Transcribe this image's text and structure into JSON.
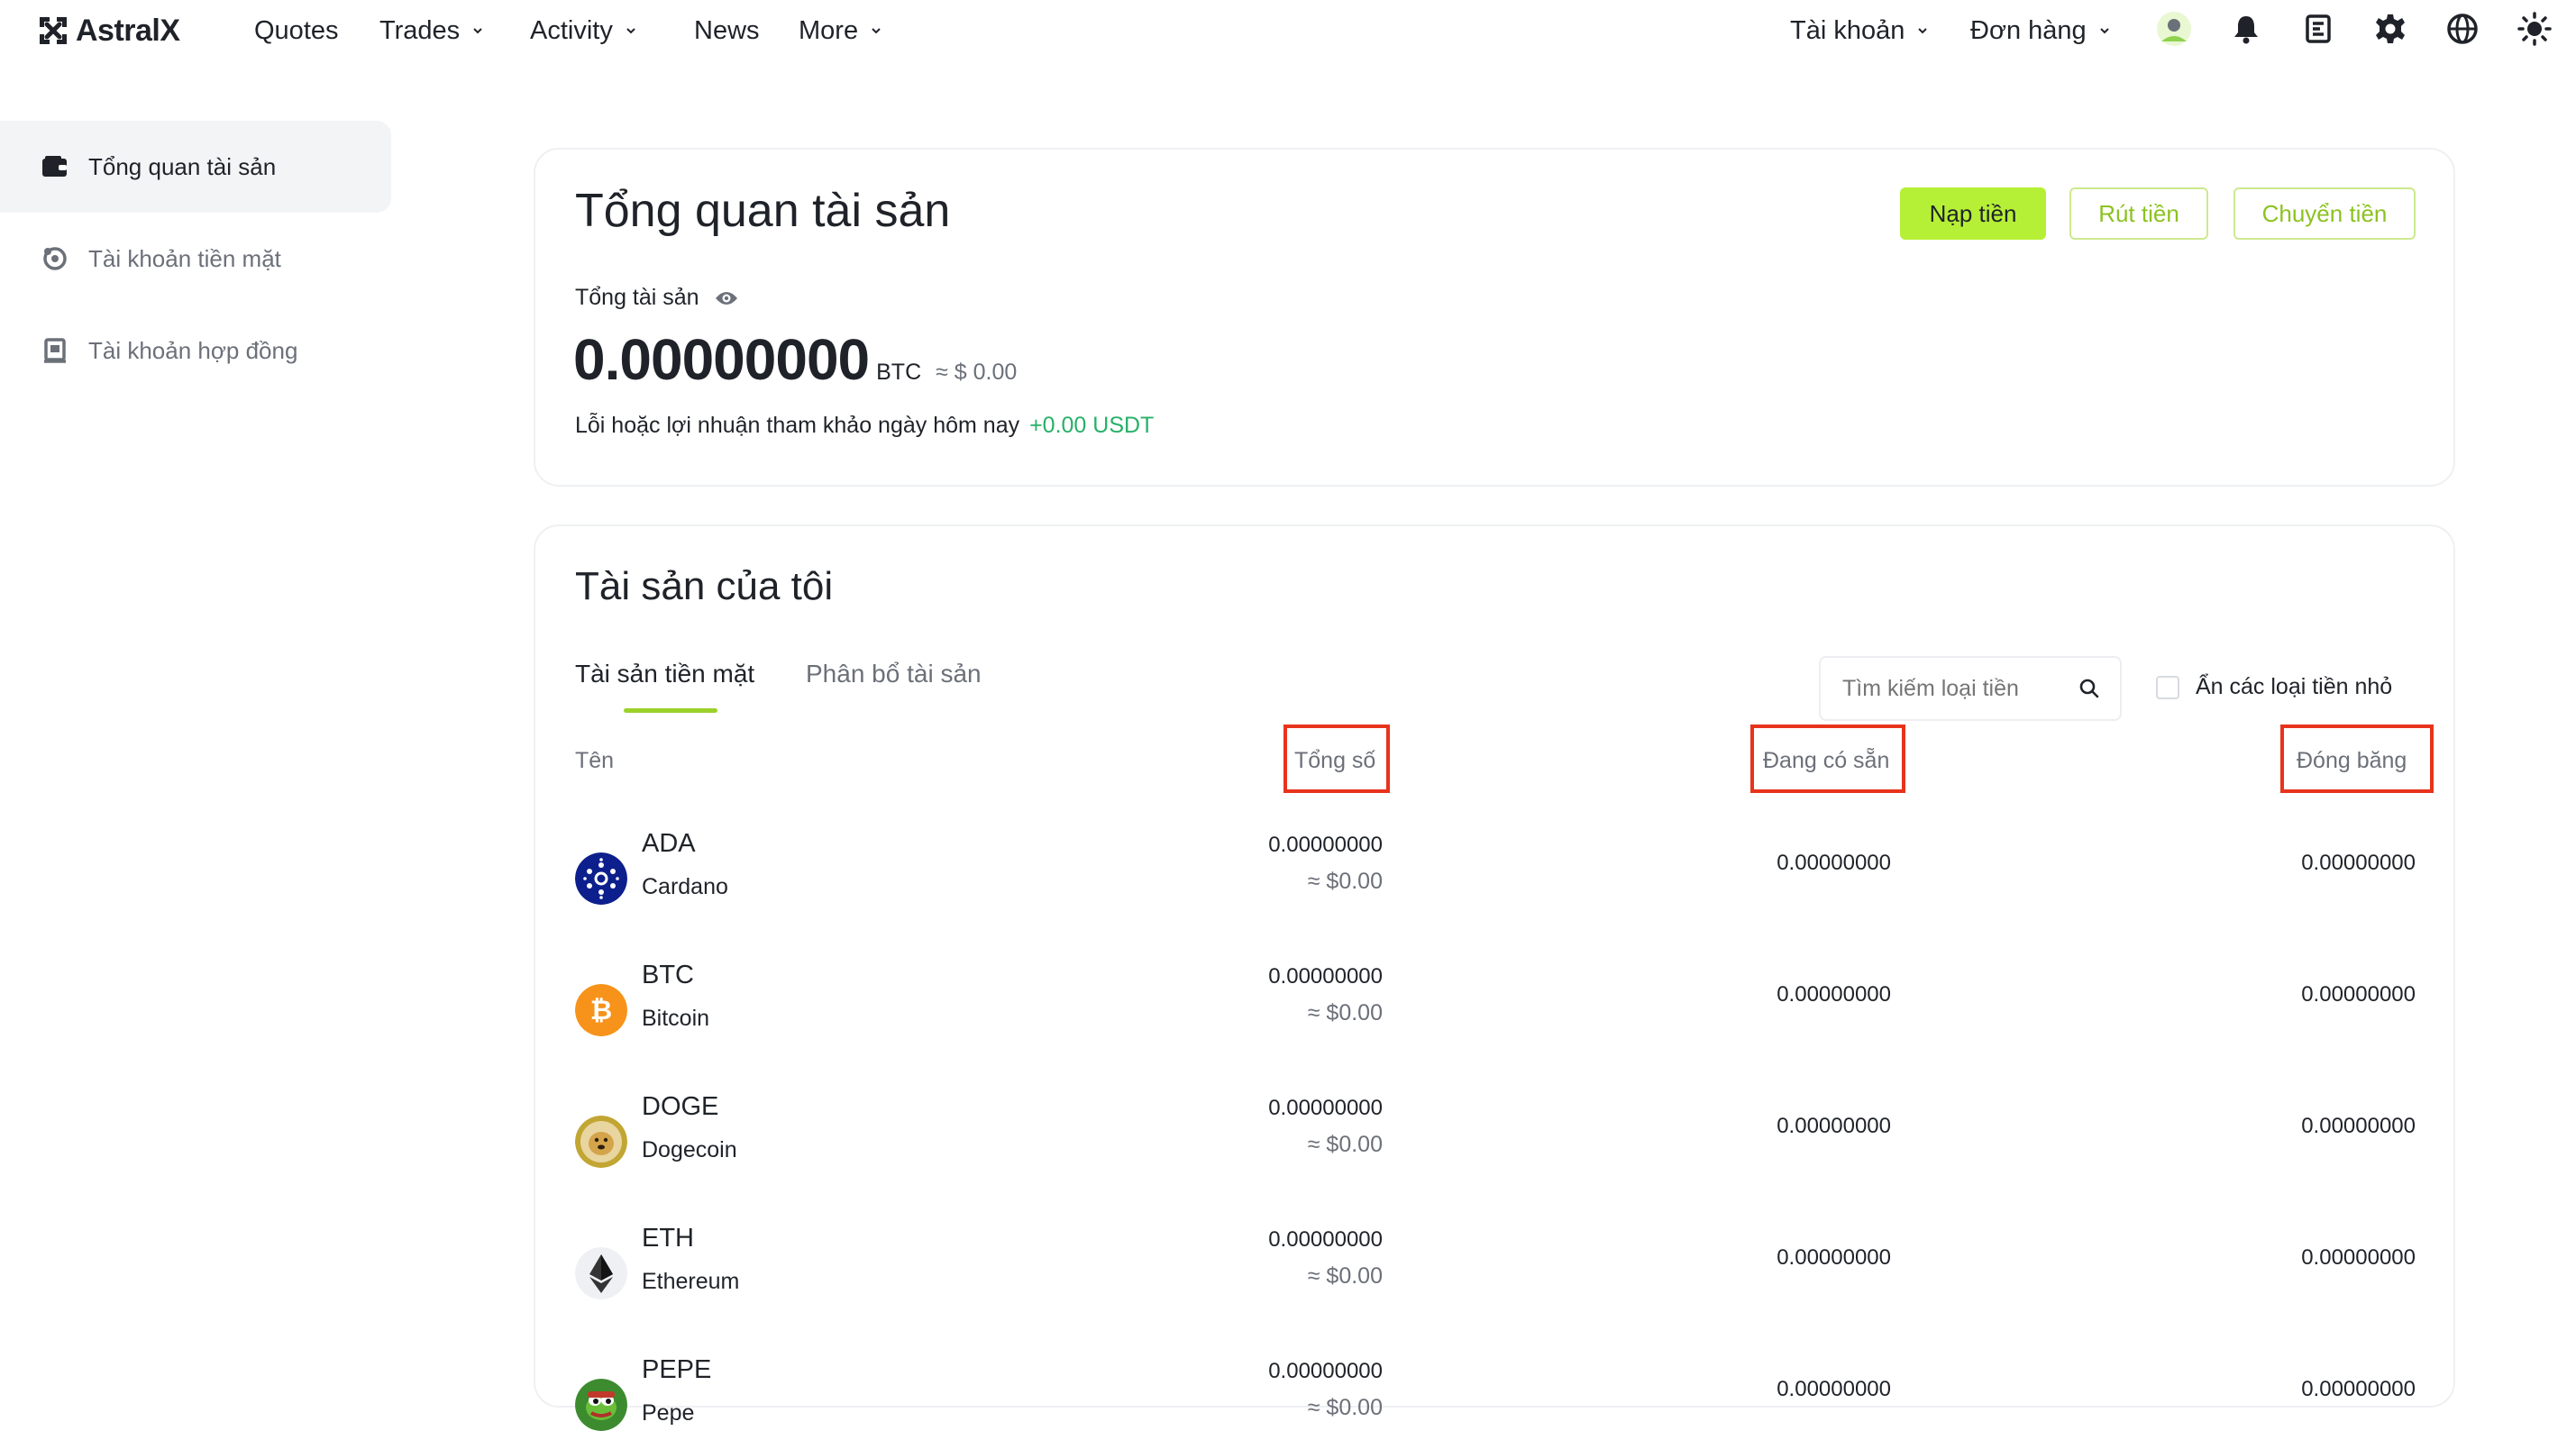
{
  "brand": {
    "name": "AstralX"
  },
  "nav": {
    "quotes": "Quotes",
    "trades": "Trades",
    "activity": "Activity",
    "news": "News",
    "more": "More",
    "account": "Tài khoản",
    "orders": "Đơn hàng"
  },
  "sidebar": {
    "items": [
      {
        "label": "Tổng quan tài sản",
        "icon": "wallet-icon"
      },
      {
        "label": "Tài khoản tiền mặt",
        "icon": "cash-icon"
      },
      {
        "label": "Tài khoản hợp đồng",
        "icon": "contract-icon"
      }
    ]
  },
  "overview": {
    "title": "Tổng quan tài sản",
    "deposit": "Nạp tiền",
    "withdraw": "Rút tiền",
    "transfer": "Chuyển tiền",
    "total_label": "Tổng tài sản",
    "total_value": "0.00000000",
    "total_unit": "BTC",
    "total_usd": "≈ $ 0.00",
    "pnl_label": "Lỗi hoặc lợi nhuận tham khảo ngày hôm nay",
    "pnl_value": "+0.00 USDT"
  },
  "assets": {
    "title": "Tài sản của tôi",
    "tabs": [
      "Tài sản tiền mặt",
      "Phân bổ tài sản"
    ],
    "search_placeholder": "Tìm kiếm loại tiền",
    "hide_small": "Ẩn các loại tiền nhỏ",
    "columns": {
      "name": "Tên",
      "total": "Tổng số",
      "available": "Đang có sẵn",
      "frozen": "Đóng băng"
    },
    "rows": [
      {
        "symbol": "ADA",
        "name": "Cardano",
        "total": "0.00000000",
        "usd": "≈ $0.00",
        "available": "0.00000000",
        "frozen": "0.00000000"
      },
      {
        "symbol": "BTC",
        "name": "Bitcoin",
        "total": "0.00000000",
        "usd": "≈ $0.00",
        "available": "0.00000000",
        "frozen": "0.00000000"
      },
      {
        "symbol": "DOGE",
        "name": "Dogecoin",
        "total": "0.00000000",
        "usd": "≈ $0.00",
        "available": "0.00000000",
        "frozen": "0.00000000"
      },
      {
        "symbol": "ETH",
        "name": "Ethereum",
        "total": "0.00000000",
        "usd": "≈ $0.00",
        "available": "0.00000000",
        "frozen": "0.00000000"
      },
      {
        "symbol": "PEPE",
        "name": "Pepe",
        "total": "0.00000000",
        "usd": "≈ $0.00",
        "available": "0.00000000",
        "frozen": "0.00000000"
      }
    ]
  },
  "colors": {
    "accent": "#b6f036",
    "accent_text": "#8cc220",
    "positive": "#27b067",
    "highlight_box": "#e8331c"
  }
}
